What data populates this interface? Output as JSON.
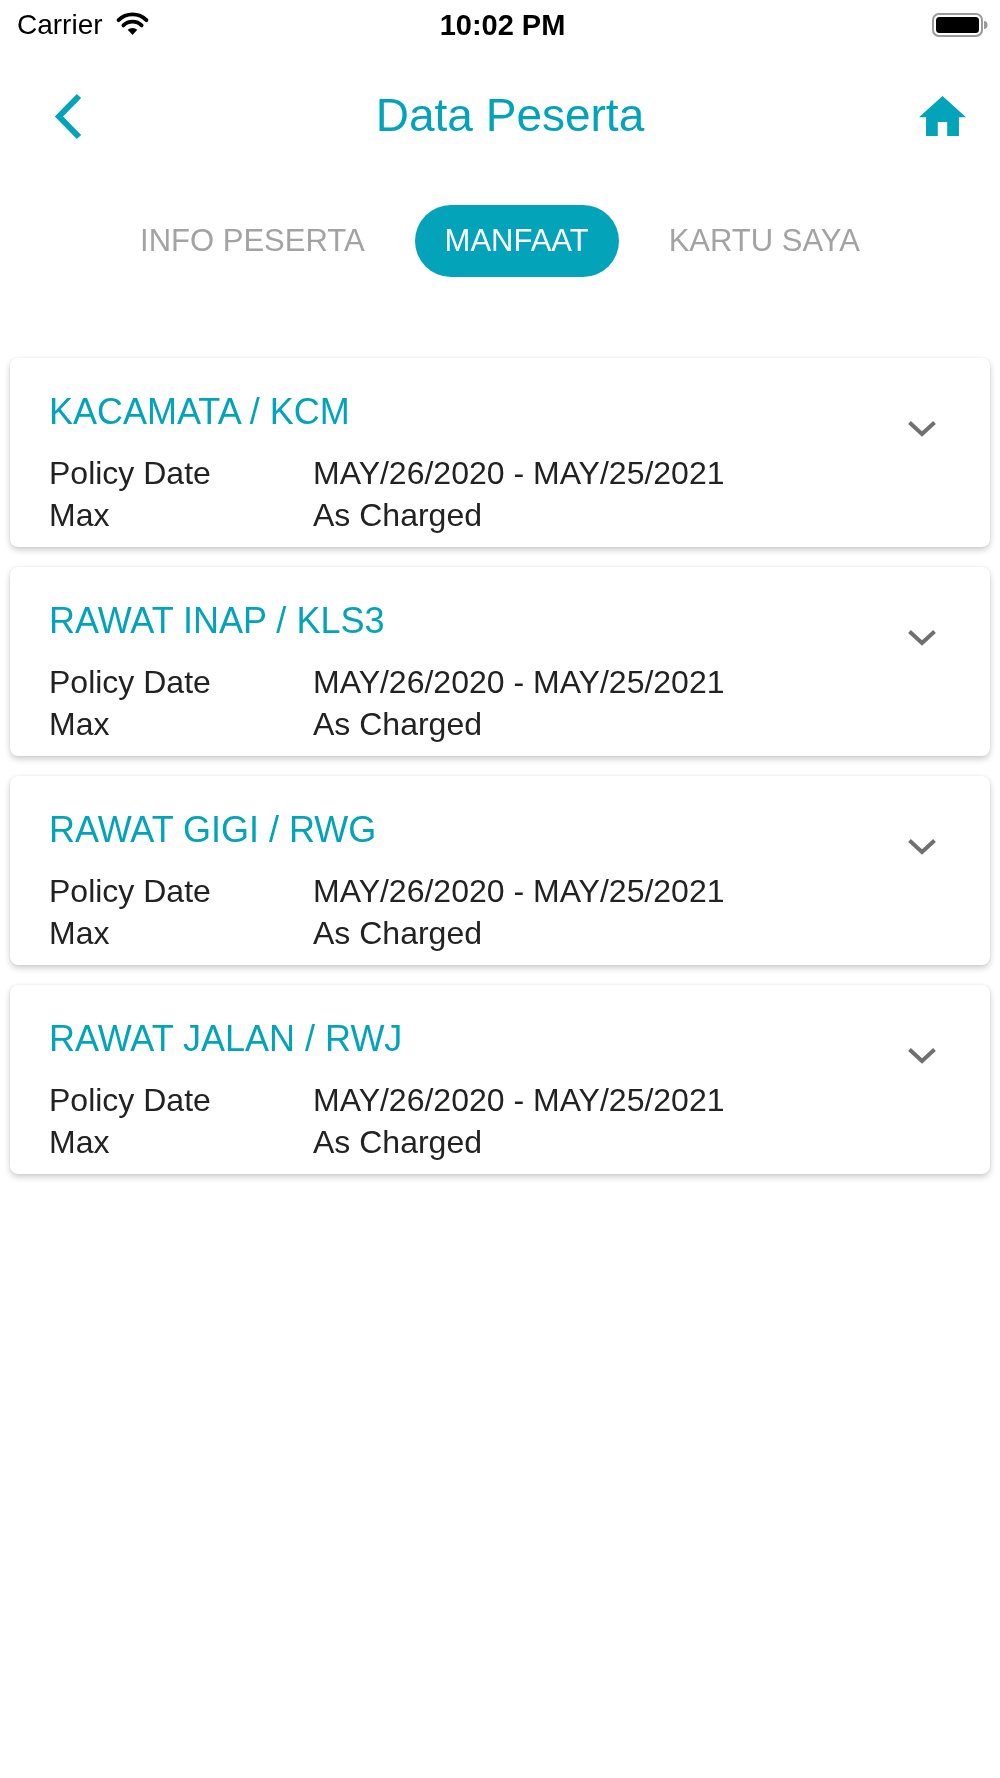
{
  "status_bar": {
    "carrier": "Carrier",
    "time": "10:02 PM"
  },
  "header": {
    "title": "Data Peserta"
  },
  "tabs": [
    {
      "label": "INFO PESERTA",
      "selected": false
    },
    {
      "label": "MANFAAT",
      "selected": true
    },
    {
      "label": "KARTU SAYA",
      "selected": false
    }
  ],
  "benefits": [
    {
      "title": "KACAMATA / KCM",
      "expanded": false,
      "rows": [
        {
          "label": "Policy Date",
          "value": "MAY/26/2020 - MAY/25/2021"
        },
        {
          "label": "Max",
          "value": "As Charged"
        }
      ]
    },
    {
      "title": "RAWAT INAP / KLS3",
      "expanded": false,
      "rows": [
        {
          "label": "Policy Date",
          "value": "MAY/26/2020 - MAY/25/2021"
        },
        {
          "label": "Max",
          "value": "As Charged"
        }
      ]
    },
    {
      "title": "RAWAT GIGI / RWG",
      "expanded": false,
      "rows": [
        {
          "label": "Policy Date",
          "value": "MAY/26/2020 - MAY/25/2021"
        },
        {
          "label": "Max",
          "value": "As Charged"
        }
      ]
    },
    {
      "title": "RAWAT JALAN / RWJ",
      "expanded": false,
      "rows": [
        {
          "label": "Policy Date",
          "value": "MAY/26/2020 - MAY/25/2021"
        },
        {
          "label": "Max",
          "value": "As Charged"
        }
      ]
    }
  ]
}
